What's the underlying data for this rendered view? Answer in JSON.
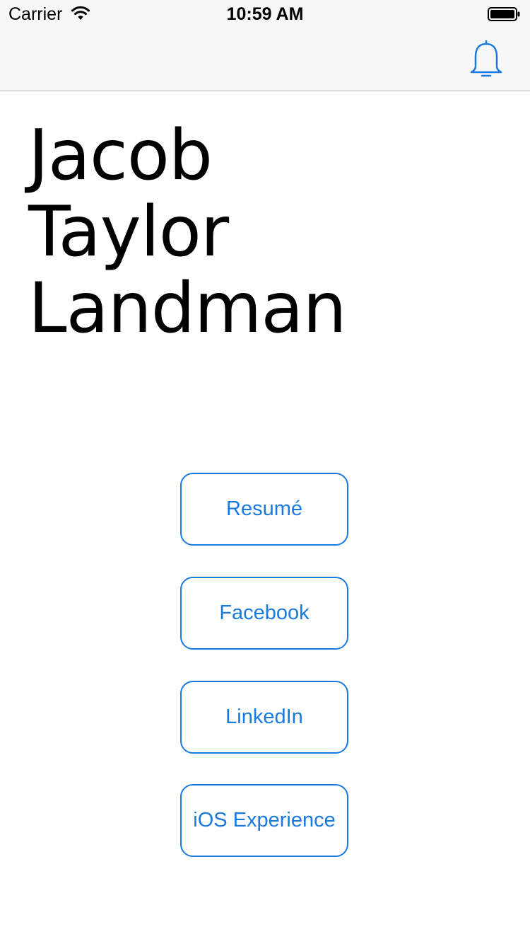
{
  "status_bar": {
    "carrier": "Carrier",
    "time": "10:59 AM",
    "wifi_icon": "wifi-icon",
    "battery_icon": "battery-icon"
  },
  "nav_bar": {
    "notification_icon": "bell-icon"
  },
  "profile": {
    "name_lines": [
      "Jacob",
      "Taylor",
      "Landman"
    ]
  },
  "buttons": [
    {
      "label": "Resumé"
    },
    {
      "label": "Facebook"
    },
    {
      "label": "LinkedIn"
    },
    {
      "label": "iOS Experience"
    }
  ],
  "colors": {
    "accent": "#1a7ae0",
    "bar_background": "#f7f7f7",
    "text": "#000000"
  }
}
